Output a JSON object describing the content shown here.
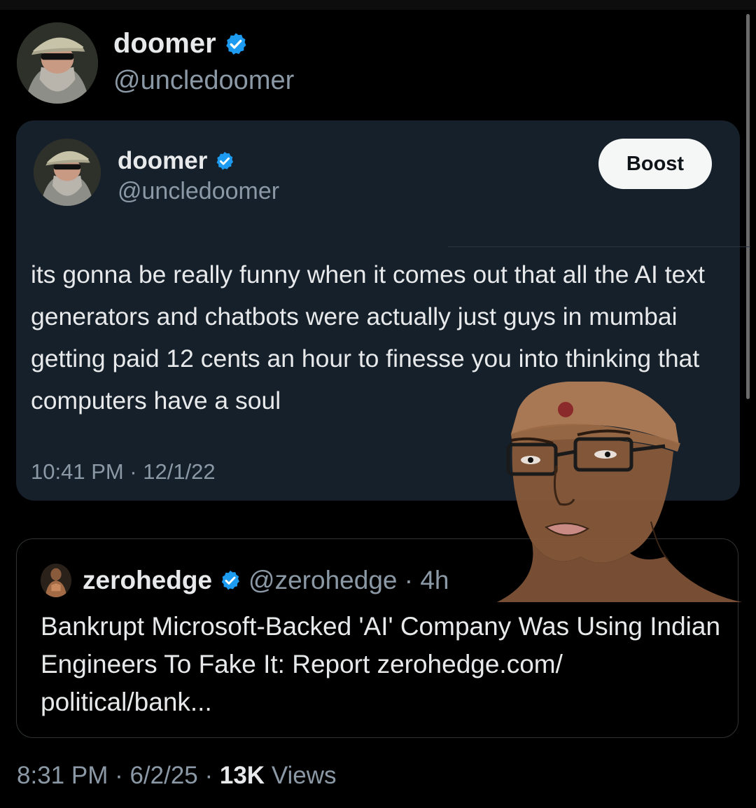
{
  "post": {
    "author": {
      "display_name": "doomer",
      "handle": "@uncledoomer",
      "verified": true
    },
    "embedded_post": {
      "author": {
        "display_name": "doomer",
        "handle": "@uncledoomer",
        "verified": true
      },
      "action_button": "Boost",
      "text": "its gonna be really funny when it comes out that all the AI text generators and chatbots were actually just guys in mumbai getting paid 12 cents an hour to finesse you into thinking that computers have a soul",
      "timestamp": "10:41 PM · 12/1/22"
    },
    "quoted_post": {
      "author": {
        "display_name": "zerohedge",
        "handle_time": "@zerohedge · 4h",
        "verified": true
      },
      "text": "Bankrupt Microsoft-Backed 'AI' Company Was Using Indian Engineers To Fake It: Report zerohedge.com/ political/bank..."
    },
    "footer": {
      "time_date": "8:31 PM · 6/2/25 · ",
      "views_count": "13K",
      "views_label": " Views"
    }
  },
  "colors": {
    "background": "#000000",
    "card_background": "#16202b",
    "text_primary": "#e7e9ea",
    "text_secondary": "#8b98a5",
    "verified_blue": "#1d9bf0",
    "button_background": "#f5f6f6"
  },
  "icons": {
    "verified": "verified-badge-icon",
    "avatar_doomer": "doomer-avatar",
    "avatar_zerohedge": "zerohedge-avatar"
  }
}
